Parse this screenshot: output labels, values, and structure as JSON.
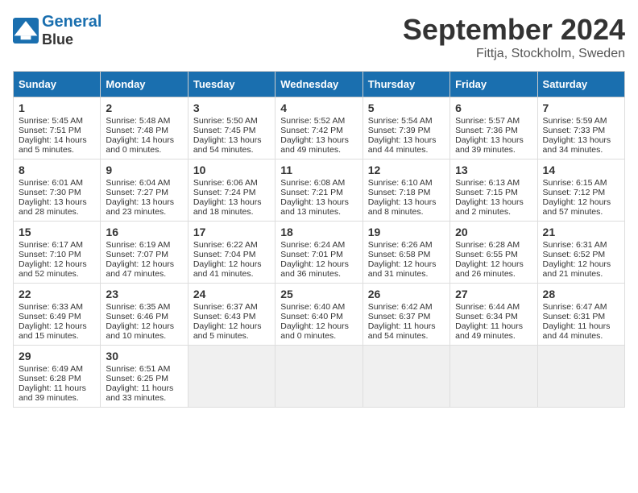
{
  "header": {
    "logo_line1": "General",
    "logo_line2": "Blue",
    "month_title": "September 2024",
    "location": "Fittja, Stockholm, Sweden"
  },
  "weekdays": [
    "Sunday",
    "Monday",
    "Tuesday",
    "Wednesday",
    "Thursday",
    "Friday",
    "Saturday"
  ],
  "weeks": [
    [
      {
        "day": 1,
        "sunrise": "5:45 AM",
        "sunset": "7:51 PM",
        "daylight": "14 hours and 5 minutes."
      },
      {
        "day": 2,
        "sunrise": "5:48 AM",
        "sunset": "7:48 PM",
        "daylight": "14 hours and 0 minutes."
      },
      {
        "day": 3,
        "sunrise": "5:50 AM",
        "sunset": "7:45 PM",
        "daylight": "13 hours and 54 minutes."
      },
      {
        "day": 4,
        "sunrise": "5:52 AM",
        "sunset": "7:42 PM",
        "daylight": "13 hours and 49 minutes."
      },
      {
        "day": 5,
        "sunrise": "5:54 AM",
        "sunset": "7:39 PM",
        "daylight": "13 hours and 44 minutes."
      },
      {
        "day": 6,
        "sunrise": "5:57 AM",
        "sunset": "7:36 PM",
        "daylight": "13 hours and 39 minutes."
      },
      {
        "day": 7,
        "sunrise": "5:59 AM",
        "sunset": "7:33 PM",
        "daylight": "13 hours and 34 minutes."
      }
    ],
    [
      {
        "day": 8,
        "sunrise": "6:01 AM",
        "sunset": "7:30 PM",
        "daylight": "13 hours and 28 minutes."
      },
      {
        "day": 9,
        "sunrise": "6:04 AM",
        "sunset": "7:27 PM",
        "daylight": "13 hours and 23 minutes."
      },
      {
        "day": 10,
        "sunrise": "6:06 AM",
        "sunset": "7:24 PM",
        "daylight": "13 hours and 18 minutes."
      },
      {
        "day": 11,
        "sunrise": "6:08 AM",
        "sunset": "7:21 PM",
        "daylight": "13 hours and 13 minutes."
      },
      {
        "day": 12,
        "sunrise": "6:10 AM",
        "sunset": "7:18 PM",
        "daylight": "13 hours and 8 minutes."
      },
      {
        "day": 13,
        "sunrise": "6:13 AM",
        "sunset": "7:15 PM",
        "daylight": "13 hours and 2 minutes."
      },
      {
        "day": 14,
        "sunrise": "6:15 AM",
        "sunset": "7:12 PM",
        "daylight": "12 hours and 57 minutes."
      }
    ],
    [
      {
        "day": 15,
        "sunrise": "6:17 AM",
        "sunset": "7:10 PM",
        "daylight": "12 hours and 52 minutes."
      },
      {
        "day": 16,
        "sunrise": "6:19 AM",
        "sunset": "7:07 PM",
        "daylight": "12 hours and 47 minutes."
      },
      {
        "day": 17,
        "sunrise": "6:22 AM",
        "sunset": "7:04 PM",
        "daylight": "12 hours and 41 minutes."
      },
      {
        "day": 18,
        "sunrise": "6:24 AM",
        "sunset": "7:01 PM",
        "daylight": "12 hours and 36 minutes."
      },
      {
        "day": 19,
        "sunrise": "6:26 AM",
        "sunset": "6:58 PM",
        "daylight": "12 hours and 31 minutes."
      },
      {
        "day": 20,
        "sunrise": "6:28 AM",
        "sunset": "6:55 PM",
        "daylight": "12 hours and 26 minutes."
      },
      {
        "day": 21,
        "sunrise": "6:31 AM",
        "sunset": "6:52 PM",
        "daylight": "12 hours and 21 minutes."
      }
    ],
    [
      {
        "day": 22,
        "sunrise": "6:33 AM",
        "sunset": "6:49 PM",
        "daylight": "12 hours and 15 minutes."
      },
      {
        "day": 23,
        "sunrise": "6:35 AM",
        "sunset": "6:46 PM",
        "daylight": "12 hours and 10 minutes."
      },
      {
        "day": 24,
        "sunrise": "6:37 AM",
        "sunset": "6:43 PM",
        "daylight": "12 hours and 5 minutes."
      },
      {
        "day": 25,
        "sunrise": "6:40 AM",
        "sunset": "6:40 PM",
        "daylight": "12 hours and 0 minutes."
      },
      {
        "day": 26,
        "sunrise": "6:42 AM",
        "sunset": "6:37 PM",
        "daylight": "11 hours and 54 minutes."
      },
      {
        "day": 27,
        "sunrise": "6:44 AM",
        "sunset": "6:34 PM",
        "daylight": "11 hours and 49 minutes."
      },
      {
        "day": 28,
        "sunrise": "6:47 AM",
        "sunset": "6:31 PM",
        "daylight": "11 hours and 44 minutes."
      }
    ],
    [
      {
        "day": 29,
        "sunrise": "6:49 AM",
        "sunset": "6:28 PM",
        "daylight": "11 hours and 39 minutes."
      },
      {
        "day": 30,
        "sunrise": "6:51 AM",
        "sunset": "6:25 PM",
        "daylight": "11 hours and 33 minutes."
      },
      null,
      null,
      null,
      null,
      null
    ]
  ]
}
